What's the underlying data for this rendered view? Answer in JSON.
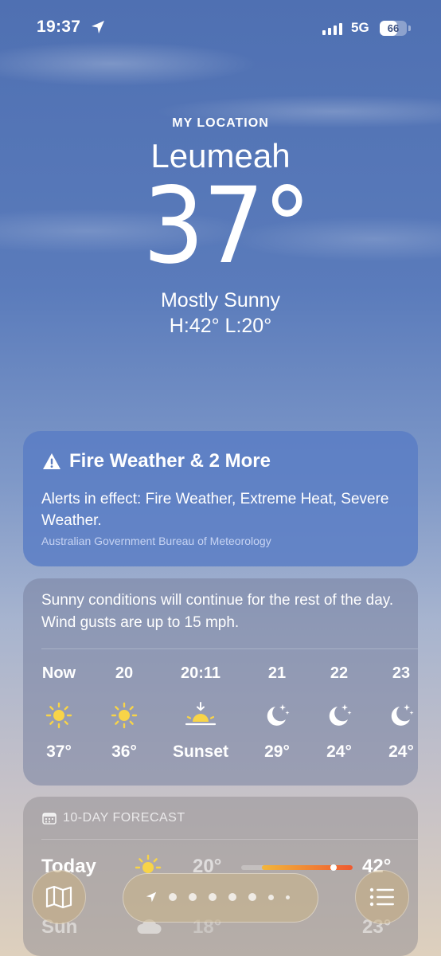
{
  "status_bar": {
    "time": "19:37",
    "network": "5G",
    "battery": "66",
    "battery_level": 0.66
  },
  "location": {
    "label": "MY LOCATION",
    "city": "Leumeah",
    "temperature": "37°",
    "condition": "Mostly Sunny",
    "high_low": "H:42°  L:20°"
  },
  "alert": {
    "title": "Fire Weather & 2 More",
    "body": "Alerts in effect: Fire Weather, Extreme Heat, Severe Weather.",
    "source": "Australian Government Bureau of Meteorology"
  },
  "hourly": {
    "summary": "Sunny conditions will continue for the rest of the day. Wind gusts are up to 15 mph.",
    "hours": [
      {
        "label": "Now",
        "icon": "sun-icon",
        "temp": "37°"
      },
      {
        "label": "20",
        "icon": "sun-icon",
        "temp": "36°"
      },
      {
        "label": "20:11",
        "icon": "sunset-icon",
        "temp": "Sunset"
      },
      {
        "label": "21",
        "icon": "moon-stars-icon",
        "temp": "29°"
      },
      {
        "label": "22",
        "icon": "moon-stars-icon",
        "temp": "24°"
      },
      {
        "label": "23",
        "icon": "moon-stars-icon",
        "temp": "24°"
      }
    ]
  },
  "forecast": {
    "header": "10-DAY FORECAST",
    "days": [
      {
        "day": "Today",
        "icon": "sun-icon",
        "low": "20°",
        "high": "42°"
      },
      {
        "day": "Sun",
        "icon": "cloud-icon",
        "low": "18°",
        "high": "23°"
      }
    ]
  },
  "colors": {
    "sun": "#f8d448",
    "temp_bar_start": "#f2b63a",
    "temp_bar_end": "#ef5a30"
  }
}
